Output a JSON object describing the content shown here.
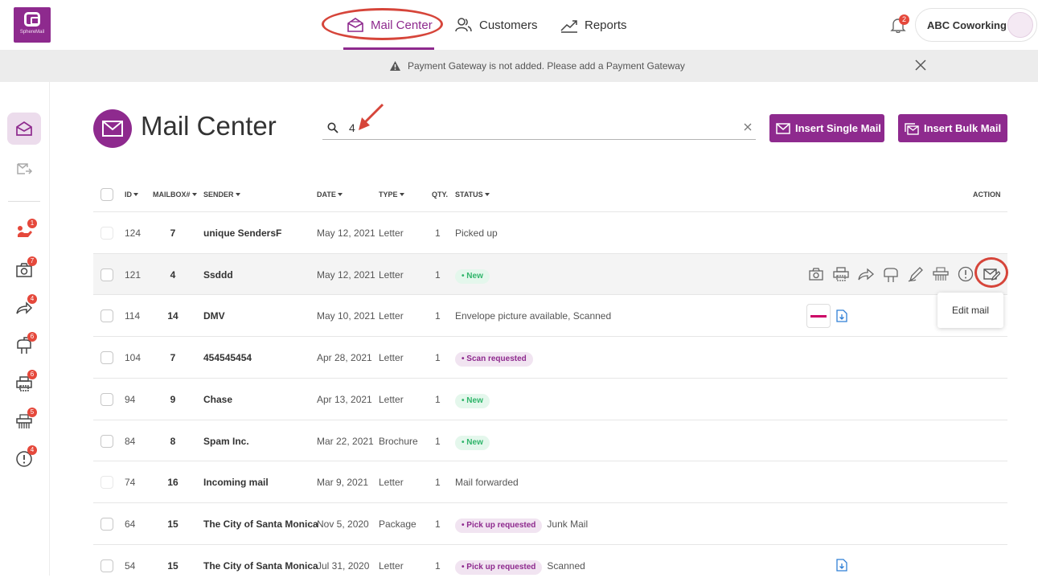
{
  "app": {
    "logo_text": "SphereMail"
  },
  "nav": {
    "mail_center": "Mail Center",
    "customers": "Customers",
    "reports": "Reports"
  },
  "notifications": {
    "count": "2"
  },
  "account": {
    "name": "ABC Coworking"
  },
  "banner": {
    "message": "Payment Gateway is not added. Please add a  Payment Gateway"
  },
  "sidebar": {
    "badges": [
      "1",
      "7",
      "4",
      "6",
      "6",
      "5",
      "4"
    ]
  },
  "page": {
    "title": "Mail Center"
  },
  "search": {
    "value": "4"
  },
  "buttons": {
    "insert_single": "Insert Single Mail",
    "insert_bulk": "Insert Bulk Mail"
  },
  "table": {
    "headers": {
      "id": "ID",
      "mailbox": "MAILBOX#",
      "sender": "SENDER",
      "date": "DATE",
      "type": "TYPE",
      "qty": "QTY.",
      "status": "STATUS",
      "action": "ACTION"
    },
    "rows": [
      {
        "id": "124",
        "mailbox": "7",
        "sender": "unique SendersF",
        "date": "May 12, 2021",
        "type": "Letter",
        "qty": "1",
        "status": "Picked up",
        "pill": "",
        "extra": ""
      },
      {
        "id": "121",
        "mailbox": "4",
        "sender": "Ssddd",
        "date": "May 12, 2021",
        "type": "Letter",
        "qty": "1",
        "status": "",
        "pill": "• New",
        "extra": ""
      },
      {
        "id": "114",
        "mailbox": "14",
        "sender": "DMV",
        "date": "May 10, 2021",
        "type": "Letter",
        "qty": "1",
        "status": "Envelope picture available,  Scanned",
        "pill": "",
        "extra": ""
      },
      {
        "id": "104",
        "mailbox": "7",
        "sender": "454545454",
        "date": "Apr 28, 2021",
        "type": "Letter",
        "qty": "1",
        "status": "",
        "pill": "• Scan requested",
        "extra": ""
      },
      {
        "id": "94",
        "mailbox": "9",
        "sender": "Chase",
        "date": "Apr 13, 2021",
        "type": "Letter",
        "qty": "1",
        "status": "",
        "pill": "• New",
        "extra": ""
      },
      {
        "id": "84",
        "mailbox": "8",
        "sender": "Spam Inc.",
        "date": "Mar 22, 2021",
        "type": "Brochure",
        "qty": "1",
        "status": "",
        "pill": "• New",
        "extra": ""
      },
      {
        "id": "74",
        "mailbox": "16",
        "sender": "Incoming mail",
        "date": "Mar 9, 2021",
        "type": "Letter",
        "qty": "1",
        "status": "Mail forwarded",
        "pill": "",
        "extra": ""
      },
      {
        "id": "64",
        "mailbox": "15",
        "sender": "The City of Santa Monica",
        "date": "Nov 5, 2020",
        "type": "Package",
        "qty": "1",
        "status": "",
        "pill": "• Pick up requested",
        "extra": "Junk Mail"
      },
      {
        "id": "54",
        "mailbox": "15",
        "sender": "The City of Santa Monica",
        "date": "Jul 31, 2020",
        "type": "Letter",
        "qty": "1",
        "status": "",
        "pill": "• Pick up requested",
        "extra": "Scanned"
      }
    ]
  },
  "tooltip": {
    "edit_mail": "Edit mail"
  },
  "colors": {
    "brand": "#8e2a8e",
    "annotation": "#d6453a",
    "new_pill": "#2fb56a",
    "badge": "#e5483b"
  }
}
